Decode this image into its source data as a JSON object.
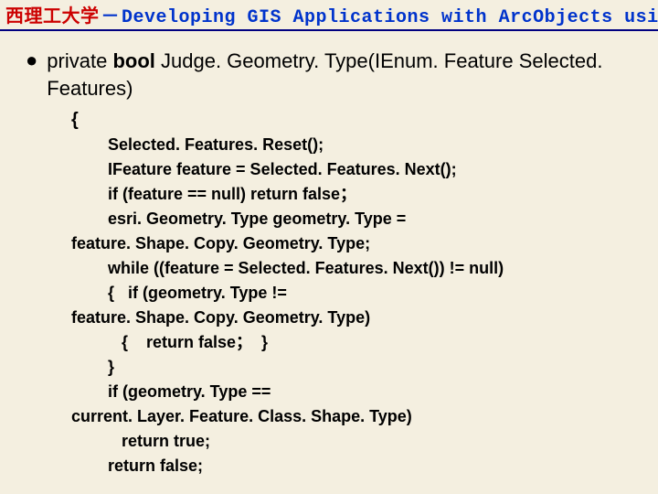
{
  "header": {
    "university": "西理工大学",
    "dash": "－",
    "course": "Developing GIS Applications with ArcObjects using C#. NE"
  },
  "signature": {
    "access": "private ",
    "ret": "bool ",
    "rest": "Judge. Geometry. Type(IEnum. Feature Selected. Features)"
  },
  "code": {
    "l0": "{",
    "l1": "Selected. Features. Reset();",
    "l2": "IFeature feature = Selected. Features. Next();",
    "l3": "if (feature == null) return false；",
    "l4": "esri. Geometry. Type geometry. Type =",
    "l5": "feature. Shape. Copy. Geometry. Type;",
    "l6": "while ((feature = Selected. Features. Next()) != null)",
    "l7": "{   if (geometry. Type !=",
    "l8": "feature. Shape. Copy. Geometry. Type)",
    "l9": "   {    return false；  }",
    "l10": "}",
    "l11": "if (geometry. Type ==",
    "l12": "current. Layer. Feature. Class. Shape. Type)",
    "l13": "   return true;",
    "l14": "return false;"
  }
}
